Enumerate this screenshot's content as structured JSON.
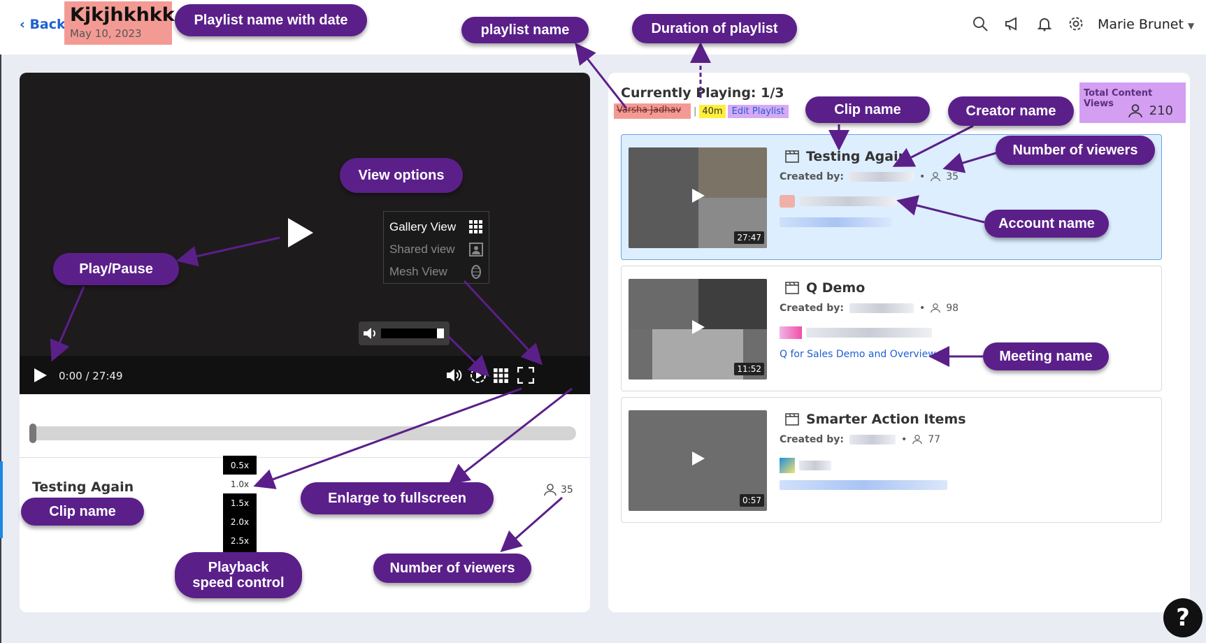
{
  "header": {
    "back_label": "Back",
    "playlist_title": "Kjkjhkhkk",
    "playlist_date": "May 10, 2023",
    "user_name": "Marie Brunet"
  },
  "player": {
    "time_display": "0:00 / 27:49",
    "clip_title": "Testing Again",
    "viewers": "35",
    "view_options": [
      {
        "label": "Gallery View",
        "icon": "grid-icon"
      },
      {
        "label": "Shared view",
        "icon": "shared-screen-icon"
      },
      {
        "label": "Mesh View",
        "icon": "mesh-icon"
      }
    ],
    "speeds": [
      "0.5x",
      "1.0x",
      "1.5x",
      "2.0x",
      "2.5x"
    ],
    "selected_speed": "1.0x"
  },
  "playlist": {
    "currently_playing": "Currently Playing: 1/3",
    "duration": "40m",
    "separator": "|",
    "edit_label": "Edit Playlist",
    "total_views_label": "Total Content Views",
    "total_views": "210",
    "clips": [
      {
        "title": "Testing Again",
        "created_by_label": "Created by:",
        "viewers": "35",
        "duration": "27:47",
        "meeting": "",
        "active": true
      },
      {
        "title": "Q Demo",
        "created_by_label": "Created by:",
        "viewers": "98",
        "duration": "11:52",
        "meeting": "Q for Sales Demo and Overview",
        "active": false
      },
      {
        "title": "Smarter Action Items",
        "created_by_label": "Created by:",
        "viewers": "77",
        "duration": "0:57",
        "meeting": "",
        "active": false
      }
    ]
  },
  "callouts": {
    "playlist_name_with_date": "Playlist name with date",
    "playlist_name": "playlist name",
    "duration_of_playlist": "Duration of playlist",
    "clip_name_top": "Clip name",
    "creator_name": "Creator name",
    "number_of_viewers_top": "Number of viewers",
    "account_name": "Account name",
    "meeting_name": "Meeting name",
    "view_options": "View options",
    "play_pause": "Play/Pause",
    "clip_name_bottom": "Clip name",
    "enlarge_fullscreen": "Enlarge to fullscreen",
    "playback_speed": "Playback\nspeed control",
    "number_of_viewers_bottom": "Number of viewers"
  },
  "help_label": "?",
  "colors": {
    "callout": "#5b1f8a",
    "link": "#1f5fd1",
    "highlight_red": "#f49a94",
    "highlight_yellow": "#ffef3a",
    "highlight_purple": "#d49ef3"
  }
}
